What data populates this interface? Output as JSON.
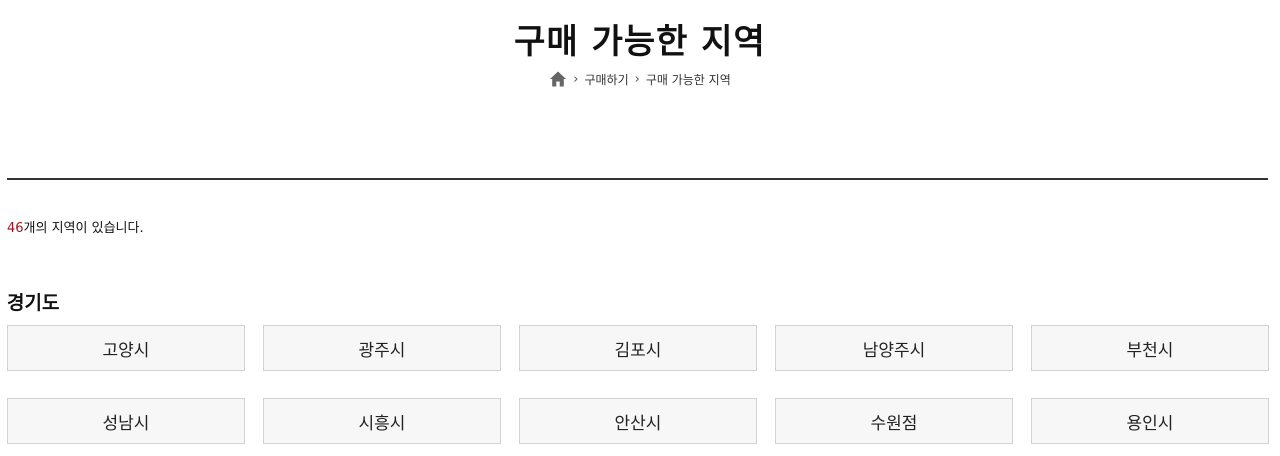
{
  "page": {
    "title": "구매 가능한 지역"
  },
  "breadcrumb": {
    "home_icon": "home-icon",
    "items": [
      "구매하기",
      "구매 가능한 지역"
    ]
  },
  "summary": {
    "count": "46",
    "suffix": "개의 지역이 있습니다."
  },
  "region": {
    "name": "경기도",
    "cities": [
      "고양시",
      "광주시",
      "김포시",
      "남양주시",
      "부천시",
      "성남시",
      "시흥시",
      "안산시",
      "수원점",
      "용인시"
    ]
  },
  "colors": {
    "accent": "#a3121e",
    "divider": "#333333",
    "button_bg": "#f7f7f7",
    "button_border": "#d3d3d3"
  }
}
